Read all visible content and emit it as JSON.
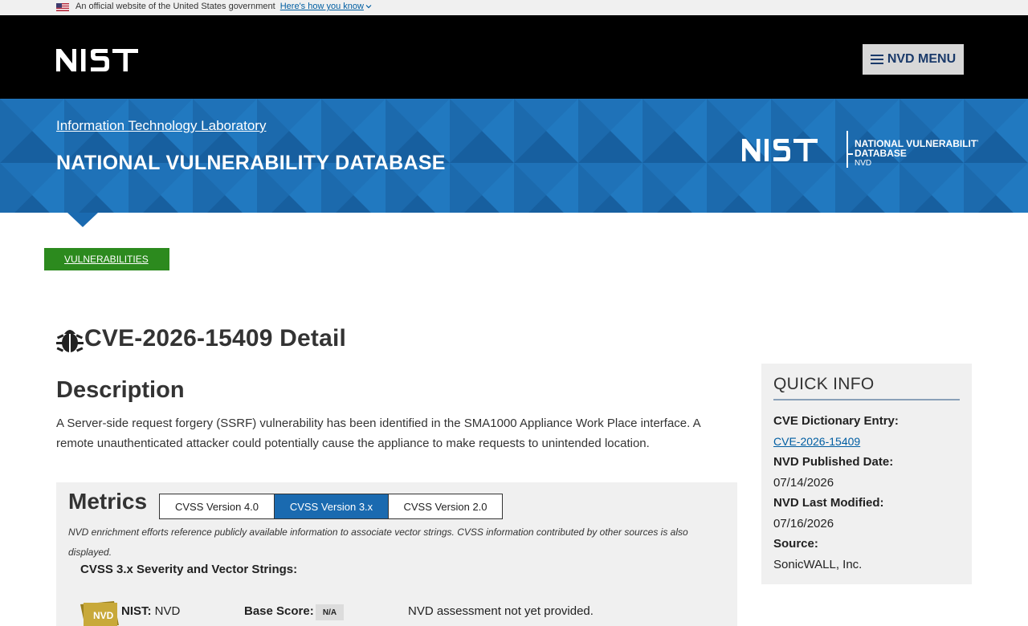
{
  "gov_banner": {
    "text": "An official website of the United States government",
    "link": "Here's how you know"
  },
  "header": {
    "menu_label": "NVD MENU"
  },
  "hero": {
    "lab_link": "Information Technology Laboratory",
    "title": "NATIONAL VULNERABILITY DATABASE"
  },
  "breadcrumb": {
    "label": "VULNERABILITIES"
  },
  "page": {
    "title": "CVE-2026-15409 Detail"
  },
  "description": {
    "heading": "Description",
    "text": "A Server-side request forgery (SSRF) vulnerability has been identified in the SMA1000 Appliance Work Place interface. A remote unauthenticated attacker could potentially cause the appliance to make requests to unintended location."
  },
  "metrics": {
    "heading": "Metrics",
    "tabs": [
      {
        "label": "CVSS Version 4.0",
        "active": false
      },
      {
        "label": "CVSS Version 3.x",
        "active": true
      },
      {
        "label": "CVSS Version 2.0",
        "active": false
      }
    ],
    "note": "NVD enrichment efforts reference publicly available information to associate vector strings. CVSS information contributed by other sources is also displayed.",
    "cvss_heading": "CVSS 3.x Severity and Vector Strings:",
    "nist_label": "NIST:",
    "nist_value": "NVD",
    "base_score_label": "Base Score:",
    "base_score_value": "N/A",
    "assessment": "NVD assessment not yet provided."
  },
  "quick_info": {
    "heading": "QUICK INFO",
    "cve_label": "CVE Dictionary Entry:",
    "cve_value": "CVE-2026-15409",
    "published_label": "NVD Published Date:",
    "published_value": "07/14/2026",
    "modified_label": "NVD Last Modified:",
    "modified_value": "07/16/2026",
    "source_label": "Source:",
    "source_value": "SonicWALL, Inc."
  },
  "colors": {
    "hero_blue": "#1a6ab0",
    "breadcrumb_green": "#2c8a1e",
    "active_tab": "#1a6ab0",
    "link": "#005ea2"
  }
}
